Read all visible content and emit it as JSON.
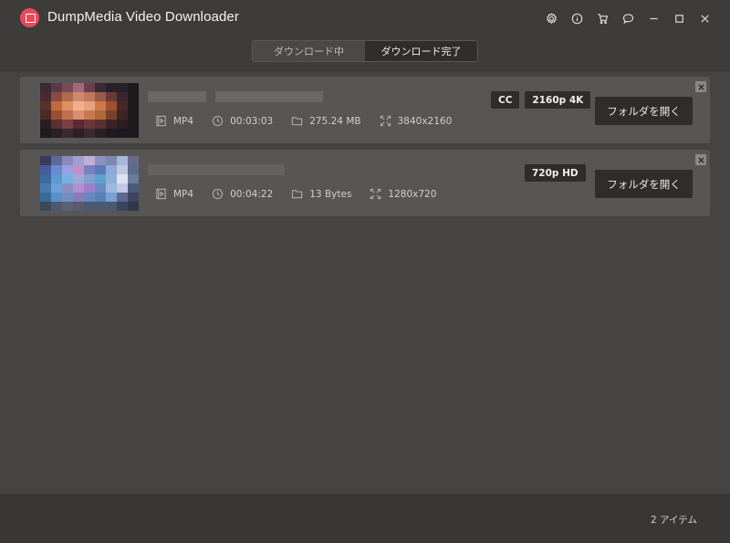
{
  "app": {
    "title": "DumpMedia Video Downloader",
    "accent": "#e8485a"
  },
  "titlebar_icons": [
    "settings-icon",
    "info-icon",
    "cart-icon",
    "feedback-icon",
    "minimize-icon",
    "maximize-icon",
    "close-icon"
  ],
  "tabs": [
    {
      "label": "ダウンロード中",
      "active": false
    },
    {
      "label": "ダウンロード完了",
      "active": true
    }
  ],
  "items": [
    {
      "format": "MP4",
      "duration": "00:03:03",
      "size": "275.24 MB",
      "resolution": "3840x2160",
      "badges": [
        "CC",
        "2160p 4K"
      ],
      "button": "フォルダを開く"
    },
    {
      "format": "MP4",
      "duration": "00:04:22",
      "size": "13 Bytes",
      "resolution": "1280x720",
      "badges": [
        "720p HD"
      ],
      "button": "フォルダを開く"
    }
  ],
  "footer": {
    "count": "2 アイテム"
  }
}
